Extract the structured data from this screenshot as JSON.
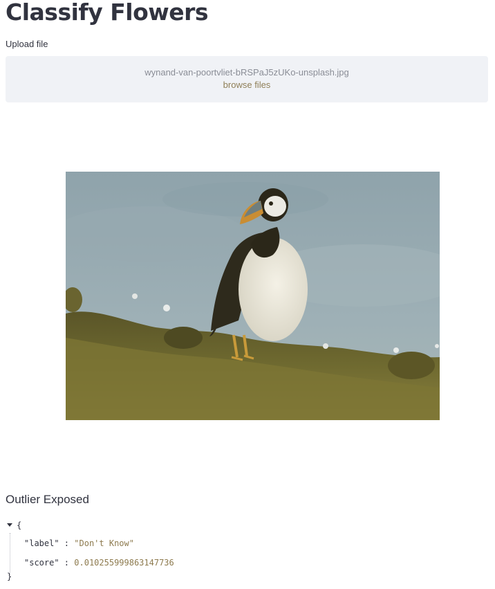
{
  "title": "Classify Flowers",
  "uploader": {
    "label": "Upload file",
    "filename": "wynand-van-poortvliet-bRSPaJ5zUKo-unsplash.jpg",
    "browse_label": "browse files"
  },
  "image": {
    "subject": "puffin-photo"
  },
  "result": {
    "heading": "Outlier Exposed",
    "open_brace": "{",
    "close_brace": "}",
    "label_key": "\"label\"",
    "label_value": "\"Don't Know\"",
    "score_key": "\"score\"",
    "score_value": "0.010255999863147736",
    "separator": " : "
  },
  "colors": {
    "text": "#31333f",
    "dropzone_bg": "#f0f2f6",
    "accent": "#8d7a4e"
  }
}
